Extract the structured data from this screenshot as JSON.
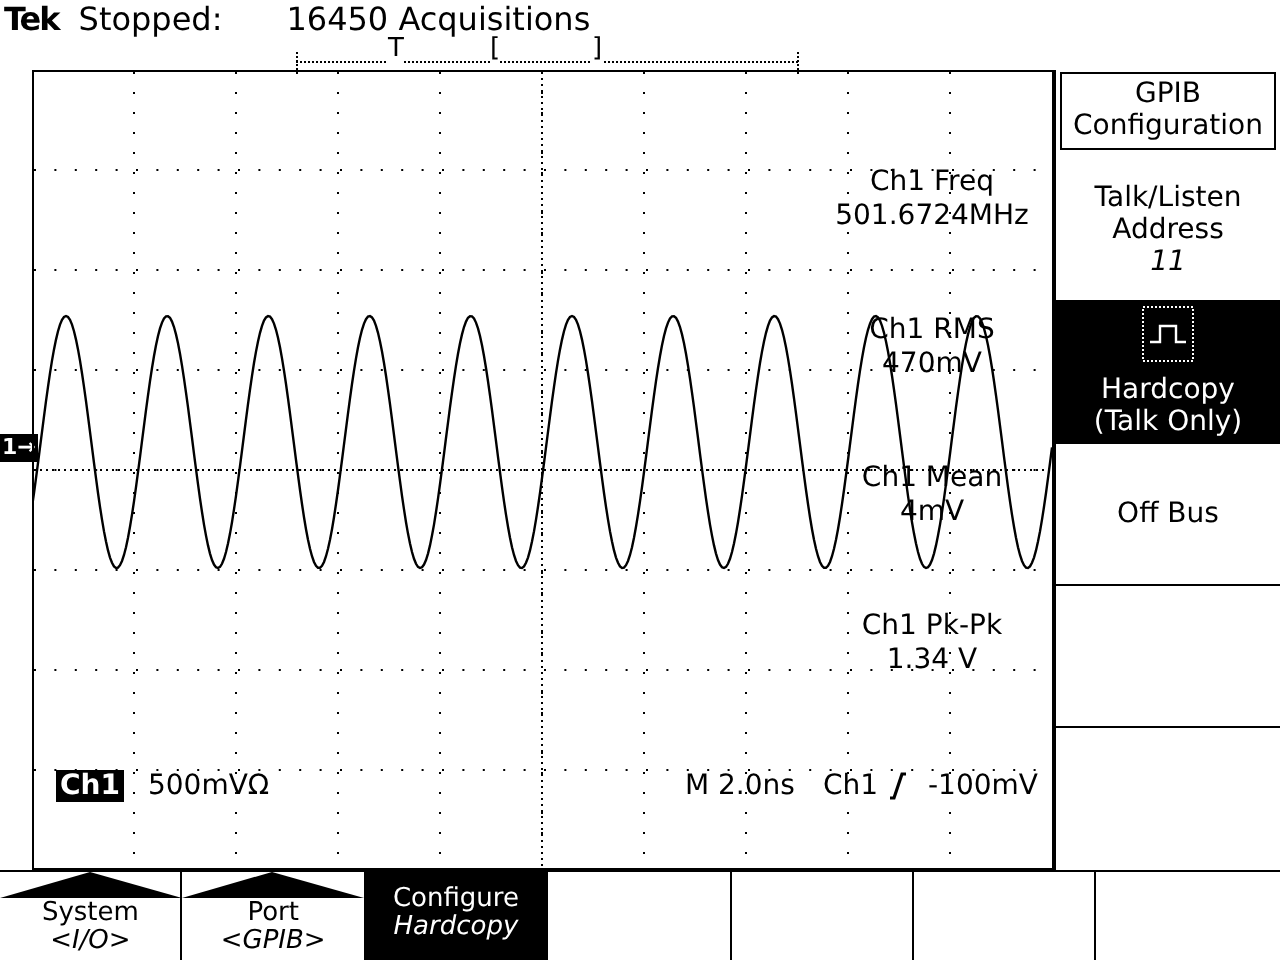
{
  "header": {
    "brand": "Tek",
    "status": "Stopped:",
    "acquisitions": "16450 Acquisitions"
  },
  "record_view": {
    "trigger_mark": "T",
    "window_start": "[",
    "window_end": "]"
  },
  "channel_marker": "1→",
  "measurements": [
    {
      "label": "Ch1 Freq",
      "value": "501.6724MHz"
    },
    {
      "label": "Ch1 RMS",
      "value": "470mV"
    },
    {
      "label": "Ch1 Mean",
      "value": "4mV"
    },
    {
      "label": "Ch1 Pk-Pk",
      "value": "1.34 V"
    }
  ],
  "readout": {
    "channel": "Ch1",
    "scale": "500mVΩ",
    "timebase": "M 2.0ns",
    "trigger_source": "Ch1",
    "trigger_level": "-100mV"
  },
  "side_menu": [
    {
      "kind": "title",
      "lines": [
        "GPIB",
        "Configuration"
      ]
    },
    {
      "kind": "option",
      "lines": [
        "Talk/Listen",
        "Address"
      ],
      "value": "11",
      "selected": false
    },
    {
      "kind": "option",
      "lines": [
        "Hardcopy",
        "(Talk Only)"
      ],
      "icon": true,
      "selected": true
    },
    {
      "kind": "option",
      "lines": [
        "Off Bus"
      ],
      "selected": false
    },
    {
      "kind": "empty"
    },
    {
      "kind": "empty"
    }
  ],
  "bottom_menu": [
    {
      "kind": "popup",
      "label": "System",
      "value": "<I/O>",
      "selected": false
    },
    {
      "kind": "popup",
      "label": "Port",
      "value": "<GPIB>",
      "selected": false
    },
    {
      "kind": "command",
      "label": "Configure",
      "value": "Hardcopy",
      "selected": true
    },
    {
      "kind": "empty"
    },
    {
      "kind": "empty"
    },
    {
      "kind": "empty"
    },
    {
      "kind": "empty"
    }
  ]
}
